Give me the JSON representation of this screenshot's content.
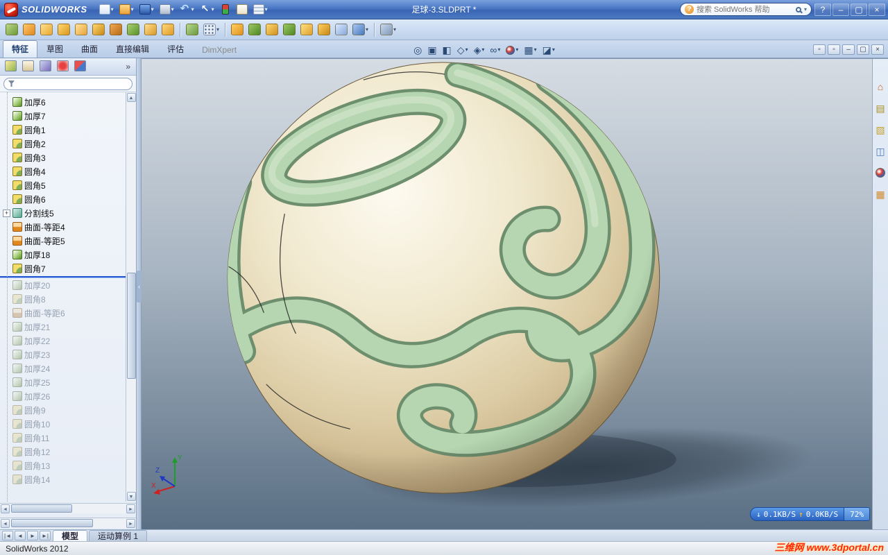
{
  "titlebar": {
    "app_name": "SOLIDWORKS",
    "doc_title": "足球-3.SLDPRT *",
    "search_placeholder": "搜索 SolidWorks 帮助"
  },
  "glyphs": {
    "chevron": "▾",
    "help": "?",
    "min": "–",
    "max": "▢",
    "close": "×",
    "up_arrow": "▲",
    "down_arrow": "▼",
    "left_arrow": "◄",
    "right_arrow": "►",
    "collapse": "‹",
    "more": "»",
    "plus": "+"
  },
  "quick_toolbar": [
    {
      "name": "new-document",
      "style": "doc",
      "dd": true
    },
    {
      "name": "open-document",
      "style": "folder",
      "dd": true
    },
    {
      "name": "save",
      "style": "save",
      "dd": true
    },
    {
      "name": "print",
      "style": "print",
      "dd": true
    },
    {
      "name": "undo",
      "style": "undo",
      "dd": true
    },
    {
      "name": "select",
      "style": "cursor",
      "dd": true
    },
    {
      "name": "rebuild",
      "style": "rebuild",
      "dd": false
    },
    {
      "name": "file-properties",
      "style": "fileprop",
      "dd": false
    },
    {
      "name": "options",
      "style": "options",
      "dd": true
    }
  ],
  "macro_toolbar": [
    {
      "name": "macro-tool-01",
      "c1": "#bcd88a",
      "c2": "#6a9a38"
    },
    {
      "name": "macro-tool-02",
      "c1": "#ffc86a",
      "c2": "#e08820"
    },
    {
      "name": "macro-tool-03",
      "c1": "#ffe090",
      "c2": "#e8a830"
    },
    {
      "name": "macro-tool-04",
      "c1": "#ffd870",
      "c2": "#d89820"
    },
    {
      "name": "macro-tool-05",
      "c1": "#ffe49a",
      "c2": "#e8a23a"
    },
    {
      "name": "macro-tool-06",
      "c1": "#ffd870",
      "c2": "#c88818"
    },
    {
      "name": "macro-tool-07",
      "c1": "#f0a850",
      "c2": "#b86a18"
    },
    {
      "name": "macro-tool-08",
      "c1": "#a8d070",
      "c2": "#58922e"
    },
    {
      "name": "macro-tool-09",
      "c1": "#ffe090",
      "c2": "#d89828"
    },
    {
      "name": "macro-tool-10",
      "c1": "#ffd87a",
      "c2": "#e09a28",
      "sep_after": true
    },
    {
      "name": "macro-tool-11",
      "c1": "#b8d890",
      "c2": "#6a9a40"
    },
    {
      "name": "macro-grid",
      "c1": "#e8edf5",
      "c2": "#b8c4d8",
      "dots": true,
      "dd": true,
      "sep_after": true
    },
    {
      "name": "macro-tool-13",
      "c1": "#ffd060",
      "c2": "#e09020"
    },
    {
      "name": "macro-tool-14",
      "c1": "#9cc860",
      "c2": "#4e8828"
    },
    {
      "name": "macro-tool-15",
      "c1": "#ffd870",
      "c2": "#d09020"
    },
    {
      "name": "macro-tool-16",
      "c1": "#9cc860",
      "c2": "#4e8828"
    },
    {
      "name": "macro-tool-17",
      "c1": "#ffe080",
      "c2": "#e0a030"
    },
    {
      "name": "macro-tool-18",
      "c1": "#ffd060",
      "c2": "#c88818"
    },
    {
      "name": "macro-tool-19",
      "c1": "#d8e8ff",
      "c2": "#88a8d8"
    },
    {
      "name": "macro-tool-20",
      "c1": "#a8c8f0",
      "c2": "#4878c0",
      "dd": true,
      "sep_after": true
    },
    {
      "name": "macro-tool-21",
      "c1": "#c8d8ec",
      "c2": "#8098b8",
      "dd": true
    }
  ],
  "command_tabs": [
    {
      "id": "features",
      "label": "特征",
      "active": true
    },
    {
      "id": "sketch",
      "label": "草图"
    },
    {
      "id": "surfaces",
      "label": "曲面"
    },
    {
      "id": "direct-editing",
      "label": "直接编辑"
    },
    {
      "id": "evaluate",
      "label": "评估"
    },
    {
      "id": "dimxpert",
      "label": "DimXpert",
      "muted": true
    }
  ],
  "headsup": [
    {
      "name": "zoom-to-fit",
      "glyph": "◎"
    },
    {
      "name": "zoom-to-area",
      "glyph": "▣"
    },
    {
      "name": "section-view",
      "glyph": "◧"
    },
    {
      "name": "view-orientation",
      "glyph": "◇",
      "dd": true
    },
    {
      "name": "display-style",
      "glyph": "◈",
      "dd": true
    },
    {
      "name": "hide-show-items",
      "glyph": "∞",
      "dd": true
    },
    {
      "name": "edit-appearance",
      "style": "ball",
      "dd": true
    },
    {
      "name": "apply-scene",
      "glyph": "▦",
      "dd": true
    },
    {
      "name": "view-settings",
      "glyph": "◪",
      "dd": true
    }
  ],
  "doc_window_controls": [
    {
      "name": "window-tile-1",
      "glyph": "▫"
    },
    {
      "name": "window-tile-2",
      "glyph": "▫"
    },
    {
      "name": "doc-minimize",
      "glyph": "–"
    },
    {
      "name": "doc-restore",
      "glyph": "▢"
    },
    {
      "name": "doc-close",
      "glyph": "×"
    }
  ],
  "panel_tabs": [
    {
      "name": "featuremanager-tab",
      "style": "fm"
    },
    {
      "name": "propertymanager-tab",
      "style": "pm"
    },
    {
      "name": "configurationmanager-tab",
      "style": "cm"
    },
    {
      "name": "dimxpertmanager-tab",
      "style": "dx"
    },
    {
      "name": "displaymanager-tab",
      "style": "dm"
    }
  ],
  "feature_tree": {
    "items": [
      {
        "label": "加厚6",
        "icon": "thicken"
      },
      {
        "label": "加厚7",
        "icon": "thicken"
      },
      {
        "label": "圆角1",
        "icon": "fillet"
      },
      {
        "label": "圆角2",
        "icon": "fillet"
      },
      {
        "label": "圆角3",
        "icon": "fillet"
      },
      {
        "label": "圆角4",
        "icon": "fillet"
      },
      {
        "label": "圆角5",
        "icon": "fillet"
      },
      {
        "label": "圆角6",
        "icon": "fillet"
      },
      {
        "label": "分割线5",
        "icon": "splitline",
        "expandable": true
      },
      {
        "label": "曲面-等距4",
        "icon": "surface-offset"
      },
      {
        "label": "曲面-等距5",
        "icon": "surface-offset"
      },
      {
        "label": "加厚18",
        "icon": "thicken"
      },
      {
        "label": "圆角7",
        "icon": "fillet",
        "rollback_after": true
      },
      {
        "label": "加厚20",
        "icon": "thicken",
        "grayed": true
      },
      {
        "label": "圆角8",
        "icon": "fillet",
        "grayed": true
      },
      {
        "label": "曲面-等距6",
        "icon": "surface-offset",
        "grayed": true
      },
      {
        "label": "加厚21",
        "icon": "thicken",
        "grayed": true
      },
      {
        "label": "加厚22",
        "icon": "thicken",
        "grayed": true
      },
      {
        "label": "加厚23",
        "icon": "thicken",
        "grayed": true
      },
      {
        "label": "加厚24",
        "icon": "thicken",
        "grayed": true
      },
      {
        "label": "加厚25",
        "icon": "thicken",
        "grayed": true
      },
      {
        "label": "加厚26",
        "icon": "thicken",
        "grayed": true
      },
      {
        "label": "圆角9",
        "icon": "fillet",
        "grayed": true
      },
      {
        "label": "圆角10",
        "icon": "fillet",
        "grayed": true
      },
      {
        "label": "圆角11",
        "icon": "fillet",
        "grayed": true
      },
      {
        "label": "圆角12",
        "icon": "fillet",
        "grayed": true
      },
      {
        "label": "圆角13",
        "icon": "fillet",
        "grayed": true
      },
      {
        "label": "圆角14",
        "icon": "fillet",
        "grayed": true
      }
    ]
  },
  "taskpane": [
    {
      "name": "solidworks-resources",
      "glyph": "⌂",
      "color": "#c8641e"
    },
    {
      "name": "design-library",
      "glyph": "▤",
      "color": "#a89020"
    },
    {
      "name": "file-explorer",
      "glyph": "▧",
      "color": "#c8a030"
    },
    {
      "name": "view-palette",
      "glyph": "◫",
      "color": "#4a7ab8"
    },
    {
      "name": "appearances-scenes",
      "style": "ball"
    },
    {
      "name": "custom-properties",
      "glyph": "▦",
      "color": "#d08a2a"
    }
  ],
  "bottom_tabs": {
    "nav": [
      "|◄",
      "◄",
      "►",
      "►|"
    ],
    "tabs": [
      {
        "id": "model",
        "label": "模型",
        "active": true
      },
      {
        "id": "motion-study-1",
        "label": "运动算例 1"
      }
    ]
  },
  "statusbar": {
    "text": "SolidWorks 2012"
  },
  "net_overlay": {
    "down_arrow": "↓",
    "down": "0.1KB/S",
    "up_arrow": "↑",
    "up": "0.0KB/S",
    "percent": "72%"
  },
  "watermark": {
    "text": "三维网 www.3dportal.cn"
  },
  "triad": {
    "x": "X",
    "y": "Y",
    "z": "Z"
  },
  "viewport_colors": {
    "bg_top": "#d6dce3",
    "bg_bottom": "#5a6f84",
    "ball_base": "#e9dfbd",
    "pattern_green": "#b5d6b0",
    "pattern_outline": "#6d8f6e"
  }
}
